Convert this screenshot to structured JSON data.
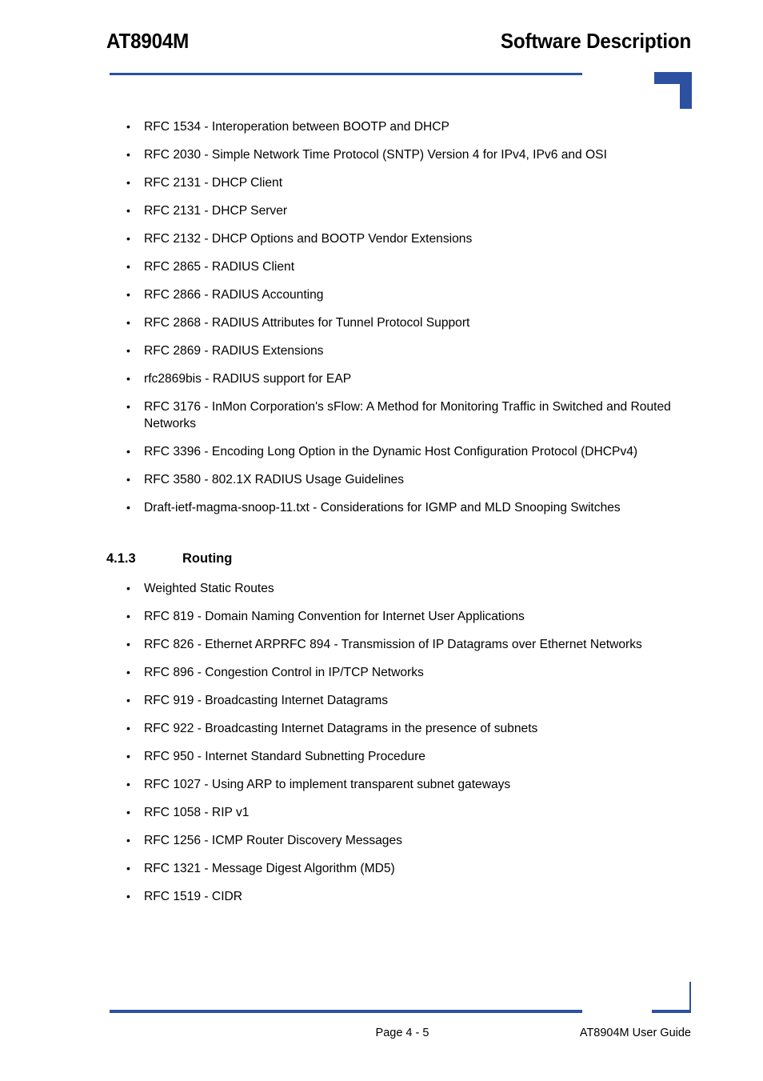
{
  "header": {
    "doc_model": "AT8904M",
    "chapter_title": "Software Description"
  },
  "content": {
    "protocol_bullets": [
      {
        "text": "RFC 1534 - Interoperation between BOOTP and DHCP",
        "justified": false
      },
      {
        "text": "RFC 2030 - Simple Network Time Protocol (SNTP) Version 4 for IPv4, IPv6 and OSI",
        "justified": false
      },
      {
        "text": "RFC 2131 - DHCP Client",
        "justified": false
      },
      {
        "text": "RFC 2131 - DHCP Server",
        "justified": false
      },
      {
        "text": "RFC 2132 - DHCP Options and BOOTP Vendor Extensions",
        "justified": false
      },
      {
        "text": "RFC 2865 - RADIUS Client",
        "justified": false
      },
      {
        "text": "RFC 2866 - RADIUS Accounting",
        "justified": false
      },
      {
        "text": "RFC 2868 - RADIUS Attributes for Tunnel Protocol Support",
        "justified": false
      },
      {
        "text": "RFC 2869 - RADIUS Extensions",
        "justified": false
      },
      {
        "text": "rfc2869bis - RADIUS support for EAP",
        "justified": false
      },
      {
        "text": "RFC 3176 - InMon Corporation's sFlow: A Method for Monitoring Traffic in Switched and Routed Networks",
        "justified": false
      },
      {
        "text": "RFC 3396 - Encoding Long Option in the Dynamic Host Configuration Protocol (DHCPv4)",
        "justified": true
      },
      {
        "text": "RFC 3580 - 802.1X RADIUS Usage Guidelines",
        "justified": false
      },
      {
        "text": "Draft-ietf-magma-snoop-11.txt - Considerations for IGMP and MLD Snooping Switches",
        "justified": false
      }
    ],
    "section": {
      "number": "4.1.3",
      "title": "Routing"
    },
    "routing_bullets": [
      {
        "text": "Weighted Static Routes",
        "justified": false
      },
      {
        "text": "RFC 819 - Domain Naming Convention for Internet User Applications",
        "justified": false
      },
      {
        "text": "RFC 826 - Ethernet ARPRFC 894 - Transmission of IP Datagrams over Ethernet Networks",
        "justified": true
      },
      {
        "text": "RFC 896 - Congestion Control in IP/TCP Networks",
        "justified": false
      },
      {
        "text": "RFC 919 - Broadcasting Internet Datagrams",
        "justified": false
      },
      {
        "text": "RFC 922 - Broadcasting Internet Datagrams in the presence of subnets",
        "justified": false
      },
      {
        "text": "RFC 950 - Internet Standard Subnetting Procedure",
        "justified": false
      },
      {
        "text": "RFC 1027 - Using ARP to implement transparent subnet gateways",
        "justified": false
      },
      {
        "text": "RFC 1058 - RIP v1",
        "justified": false
      },
      {
        "text": "RFC 1256 - ICMP Router Discovery Messages",
        "justified": false
      },
      {
        "text": "RFC 1321 - Message Digest Algorithm (MD5)",
        "justified": false
      },
      {
        "text": "RFC 1519 - CIDR",
        "justified": false
      }
    ]
  },
  "footer": {
    "page_number": "Page 4 - 5",
    "doc_name": "AT8904M User Guide"
  },
  "colors": {
    "accent_blue": "#2C51A0",
    "text": "#000000",
    "background": "#FFFFFF"
  }
}
